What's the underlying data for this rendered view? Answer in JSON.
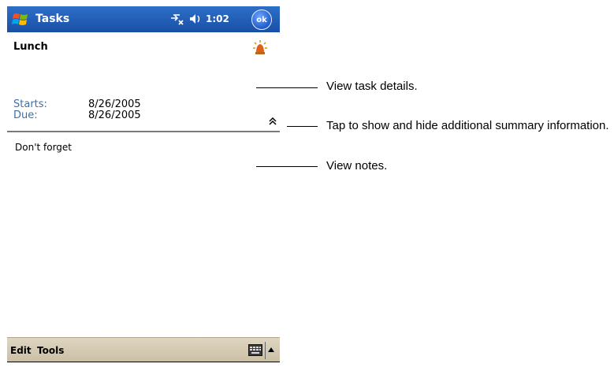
{
  "titlebar": {
    "app_title": "Tasks",
    "time": "1:02",
    "ok_label": "ok"
  },
  "task": {
    "title": "Lunch",
    "fields": [
      {
        "label": "Starts:",
        "value": "8/26/2005"
      },
      {
        "label": "Due:",
        "value": "8/26/2005"
      }
    ],
    "notes": "Don't forget"
  },
  "menubar": {
    "items": [
      "Edit",
      "Tools"
    ]
  },
  "callouts": [
    {
      "text": "View task details."
    },
    {
      "text": "Tap to show and hide additional summary information."
    },
    {
      "text": "View notes."
    }
  ],
  "colors": {
    "titlebar": "#1a4fa6",
    "field_label": "#3d6fa7",
    "menubar": "#d6ccb4"
  }
}
